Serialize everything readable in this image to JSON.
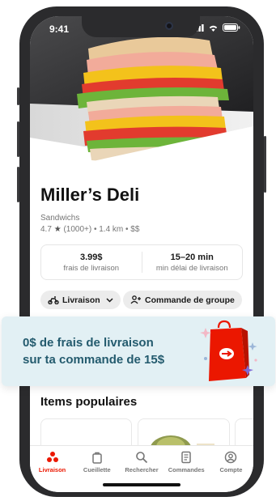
{
  "status_bar": {
    "time": "9:41"
  },
  "store": {
    "name": "Miller’s Deli",
    "category": "Sandwichs",
    "rating_value": "4.7",
    "rating_suffix": "(1000+) • 1.4 km • $$"
  },
  "info": {
    "delivery_fee_value": "3.99$",
    "delivery_fee_label": "frais de livraison",
    "delivery_time_value": "15–20 min",
    "delivery_time_label": "min délai de livraison"
  },
  "actions": {
    "mode_label": "Livraison",
    "group_order_label": "Commande de groupe"
  },
  "promo": {
    "line1": "0$ de frais de livraison",
    "line2": "sur ta commande de 15$"
  },
  "sections": {
    "popular_title": "Items populaires"
  },
  "tabs": [
    {
      "label": "Livraison",
      "icon": "delivery-icon",
      "active": true
    },
    {
      "label": "Cueillette",
      "icon": "pickup-bag-icon",
      "active": false
    },
    {
      "label": "Rechercher",
      "icon": "search-icon",
      "active": false
    },
    {
      "label": "Commandes",
      "icon": "orders-icon",
      "active": false
    },
    {
      "label": "Compte",
      "icon": "account-icon",
      "active": false
    }
  ],
  "colors": {
    "brand_red": "#eb1700",
    "promo_bg": "#e2f0f4",
    "promo_text": "#245b6e",
    "phone_frame": "#2b2b2d"
  }
}
